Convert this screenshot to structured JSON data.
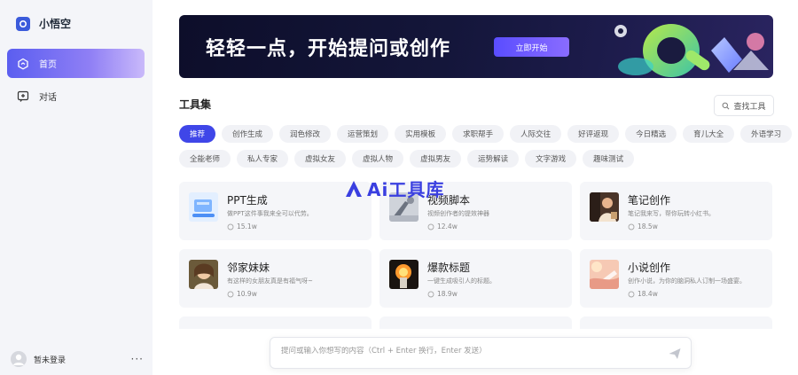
{
  "sidebar": {
    "brand": {
      "name": "小悟空",
      "icon": "brand-logo-icon"
    },
    "nav": [
      {
        "label": "首页",
        "icon": "home-icon",
        "active": true
      },
      {
        "label": "对话",
        "icon": "chat-icon",
        "active": false
      }
    ],
    "user": {
      "label": "暂未登录",
      "more": "···"
    }
  },
  "banner": {
    "title": "轻轻一点，开始提问或创作",
    "cta": "立即开始"
  },
  "tools": {
    "title": "工具集",
    "search_label": "查找工具",
    "chips_row1": [
      "推荐",
      "创作生成",
      "润色修改",
      "运营策划",
      "实用模板",
      "求职帮手",
      "人际交往",
      "好评返现",
      "今日精选",
      "育儿大全",
      "外语学习"
    ],
    "chips_row2": [
      "全能老师",
      "私人专家",
      "虚拟女友",
      "虚拟人物",
      "虚拟男友",
      "运势解读",
      "文字游戏",
      "趣味测试"
    ],
    "active_chip": "推荐"
  },
  "cards": [
    {
      "title": "PPT生成",
      "desc": "做PPT这件事我来全可以代劳。",
      "stat": "15.1w",
      "thumb": "ppt-thumb"
    },
    {
      "title": "视频脚本",
      "desc": "视频创作者的提效神器",
      "stat": "12.4w",
      "thumb": "video-thumb"
    },
    {
      "title": "笔记创作",
      "desc": "笔记我来写，帮你玩转小红书。",
      "stat": "18.5w",
      "thumb": "note-thumb"
    },
    {
      "title": "邻家妹妹",
      "desc": "有这样的女朋友真是有福气呀~",
      "stat": "10.9w",
      "thumb": "girl-thumb"
    },
    {
      "title": "爆款标题",
      "desc": "一键生成吸引人的标题。",
      "stat": "18.9w",
      "thumb": "fire-thumb"
    },
    {
      "title": "小说创作",
      "desc": "创作小说，为你的脑洞私人订制一场盛宴。",
      "stat": "18.4w",
      "thumb": "novel-thumb"
    }
  ],
  "watermark": {
    "text": "Ai工具库"
  },
  "composer": {
    "placeholder": "提问或输入你想写的内容（Ctrl + Enter 换行，Enter 发送）"
  },
  "colors": {
    "accent": "#3f46e8",
    "sidebar_bg": "#f4f5f9",
    "card_bg": "#f5f6f9"
  }
}
